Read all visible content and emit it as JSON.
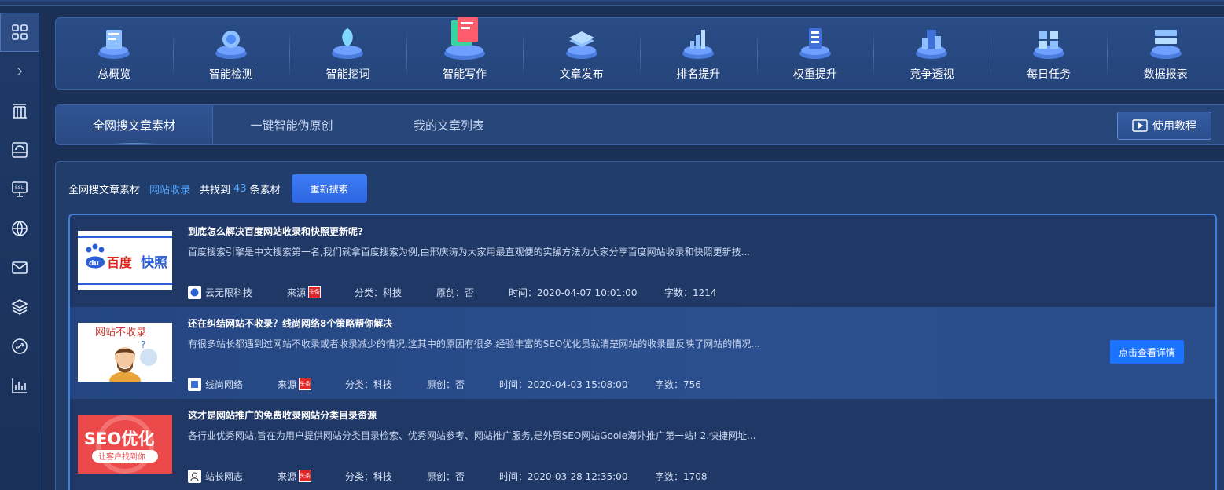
{
  "nav": [
    {
      "label": "总概览",
      "icon": "overview-icon"
    },
    {
      "label": "智能检测",
      "icon": "detect-icon"
    },
    {
      "label": "智能挖词",
      "icon": "keyword-icon"
    },
    {
      "label": "智能写作",
      "icon": "writing-icon"
    },
    {
      "label": "文章发布",
      "icon": "publish-icon"
    },
    {
      "label": "排名提升",
      "icon": "ranking-icon"
    },
    {
      "label": "权重提升",
      "icon": "weight-icon"
    },
    {
      "label": "竞争透视",
      "icon": "competition-icon"
    },
    {
      "label": "每日任务",
      "icon": "task-icon"
    },
    {
      "label": "数据报表",
      "icon": "report-icon"
    }
  ],
  "tabs": [
    {
      "label": "全网搜文章素材"
    },
    {
      "label": "一键智能伪原创"
    },
    {
      "label": "我的文章列表"
    }
  ],
  "tutorial_label": "使用教程",
  "summary": {
    "prefix": "全网搜文章素材",
    "link": "网站收录",
    "found_prefix": "共找到",
    "count": "43",
    "found_suffix": "条素材",
    "research_label": "重新搜索"
  },
  "thumbs": {
    "t1_text": "百度",
    "t1_du": "du",
    "t1_kz": "快照",
    "t2_text": "网站不收录",
    "t3_main": "SEO优化",
    "t3_sub": "让客户找到你"
  },
  "articles": [
    {
      "title": "到底怎么解决百度网站收录和快照更新呢?",
      "desc": "百度搜索引擎是中文搜索第一名,我们就拿百度搜索为例,由邢庆涛为大家用最直观便的实操方法为大家分享百度网站收录和快照更新技...",
      "author": "云无限科技",
      "source": "来源",
      "source_tag": "头条",
      "category": "分类：科技",
      "original": "原创：否",
      "time": "时间：2020-04-07 10:01:00",
      "words": "字数：1214"
    },
    {
      "title": "还在纠结网站不收录？线尚网络8个策略帮你解决",
      "desc": "有很多站长都遇到过网站不收录或者收录减少的情况,这其中的原因有很多,经验丰富的SEO优化员就清楚网站的收录量反映了网站的情况...",
      "author": "线尚网络",
      "source": "来源",
      "source_tag": "头条",
      "category": "分类：科技",
      "original": "原创：否",
      "time": "时间：2020-04-03 15:08:00",
      "words": "字数：756",
      "detail_label": "点击查看详情"
    },
    {
      "title": "这才是网站推广的免费收录网站分类目录资源",
      "desc": "各行业优秀网站,旨在为用户提供网站分类目录检索、优秀网站参考、网站推广服务,是外贸SEO网站Goole海外推广第一站! 2.快捷网址...",
      "author": "站长网志",
      "source": "来源",
      "source_tag": "头条",
      "category": "分类：科技",
      "original": "原创：否",
      "time": "时间：2020-03-28 12:35:00",
      "words": "字数：1708"
    }
  ],
  "colors": {
    "accent": "#1a73ff",
    "link": "#4fa3ff",
    "background": "#1b3057"
  }
}
